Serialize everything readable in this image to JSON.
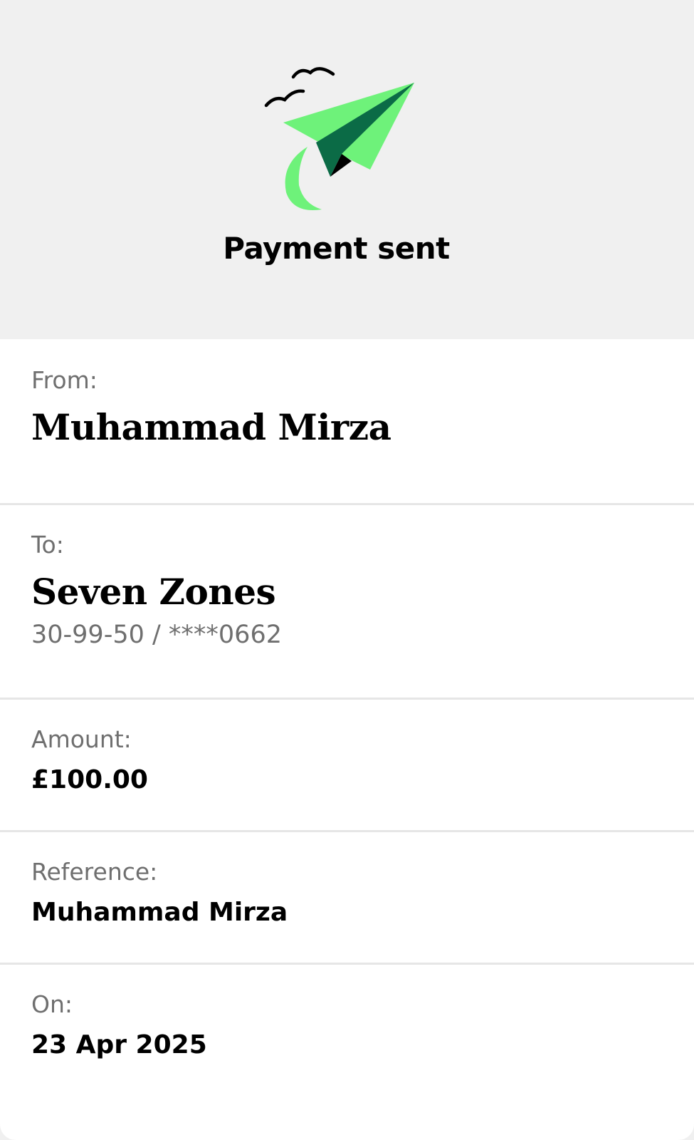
{
  "header": {
    "title": "Payment sent",
    "illustration": "paper-plane-icon",
    "colors": {
      "plane_light": "#6ef27a",
      "plane_dark": "#0b6b46",
      "birds": "#000000"
    }
  },
  "details": {
    "from": {
      "label": "From:",
      "value": "Muhammad Mirza"
    },
    "to": {
      "label": "To:",
      "value": "Seven Zones",
      "account": "30-99-50 / ****0662"
    },
    "amount": {
      "label": "Amount:",
      "value": "£100.00"
    },
    "reference": {
      "label": "Reference:",
      "value": "Muhammad Mirza"
    },
    "on": {
      "label": "On:",
      "value": "23 Apr 2025"
    }
  }
}
